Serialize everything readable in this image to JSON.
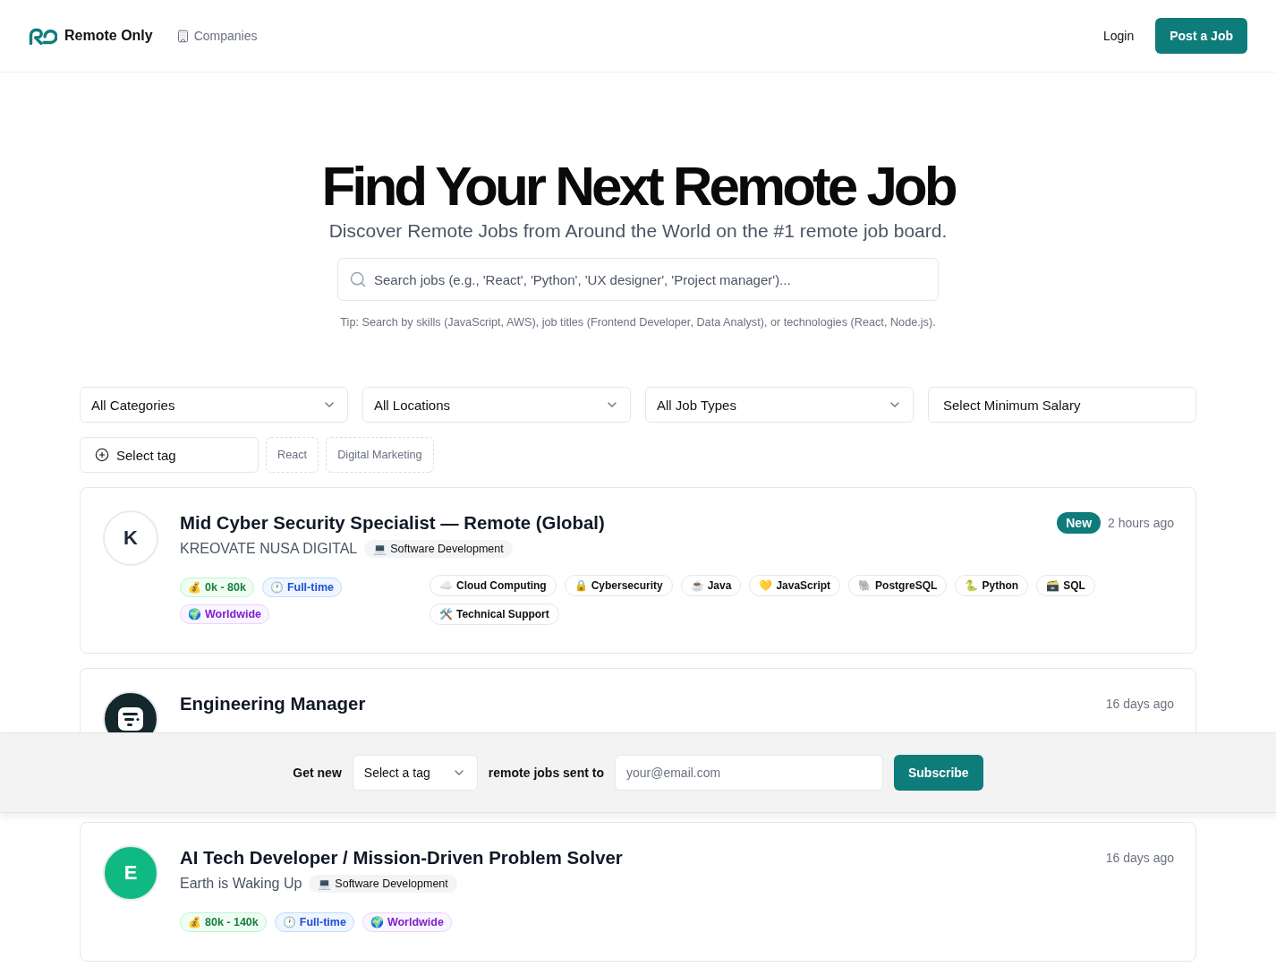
{
  "header": {
    "brand": "Remote Only",
    "nav": [
      {
        "label": "Companies"
      }
    ],
    "login": "Login",
    "post_job": "Post a Job"
  },
  "hero": {
    "title": "Find Your Next Remote Job",
    "subtitle": "Discover Remote Jobs from Around the World on the #1 remote job board.",
    "search": {
      "placeholder": "Search jobs (e.g., 'React', 'Python', 'UX designer', 'Project manager')..."
    },
    "tip": "Tip: Search by skills (JavaScript, AWS), job titles (Frontend Developer, Data Analyst), or technologies (React, Node.js)."
  },
  "filters": [
    {
      "label": "All Categories",
      "kind": "dropdown"
    },
    {
      "label": "All Locations",
      "kind": "dropdown"
    },
    {
      "label": "All Job Types",
      "kind": "dropdown"
    },
    {
      "label": "Select Minimum Salary",
      "kind": "plain"
    }
  ],
  "tag_filter": {
    "label": "Select tag",
    "suggestions": [
      "React",
      "Digital Marketing"
    ]
  },
  "jobs": [
    {
      "avatar": {
        "kind": "letter",
        "letter": "K",
        "color": "#ffffff"
      },
      "title": "Mid Cyber Security Specialist — Remote (Global)",
      "company": "KREOVATE NUSA DIGITAL",
      "category": {
        "emoji": "💻",
        "label": "Software Development"
      },
      "badge": "New",
      "posted": "2 hours ago",
      "meta": [
        {
          "kind": "salary",
          "emoji": "💰",
          "label": "0k - 80k"
        },
        {
          "kind": "job_type",
          "emoji": "🕐",
          "label": "Full-time"
        },
        {
          "kind": "location",
          "emoji": "🌍",
          "label": "Worldwide"
        }
      ],
      "skills": [
        {
          "emoji": "☁️",
          "label": "Cloud Computing"
        },
        {
          "emoji": "🔒",
          "label": "Cybersecurity"
        },
        {
          "emoji": "☕",
          "label": "Java"
        },
        {
          "emoji": "💛",
          "label": "JavaScript"
        },
        {
          "emoji": "🐘",
          "label": "PostgreSQL"
        },
        {
          "emoji": "🐍",
          "label": "Python"
        },
        {
          "emoji": "🗃️",
          "label": "SQL"
        },
        {
          "emoji": "🛠️",
          "label": "Technical Support"
        }
      ]
    },
    {
      "avatar": {
        "kind": "logo",
        "color": "#13272c"
      },
      "title": "Engineering Manager",
      "posted": "16 days ago"
    },
    {
      "avatar": {
        "kind": "letter",
        "letter": "E",
        "color": "#10b981"
      },
      "title": "AI Tech Developer / Mission-Driven Problem Solver",
      "company": "Earth is Waking Up",
      "category": {
        "emoji": "💻",
        "label": "Software Development"
      },
      "posted": "16 days ago",
      "meta": [
        {
          "kind": "salary",
          "emoji": "💰",
          "label": "80k - 140k"
        },
        {
          "kind": "job_type",
          "emoji": "🕐",
          "label": "Full-time"
        },
        {
          "kind": "location",
          "emoji": "🌍",
          "label": "Worldwide"
        }
      ]
    }
  ],
  "subscribe_bar": {
    "prefix": "Get new",
    "tag_select": "Select a tag",
    "middle": "remote jobs sent to",
    "email": {
      "placeholder": "your@email.com"
    },
    "button": "Subscribe"
  }
}
